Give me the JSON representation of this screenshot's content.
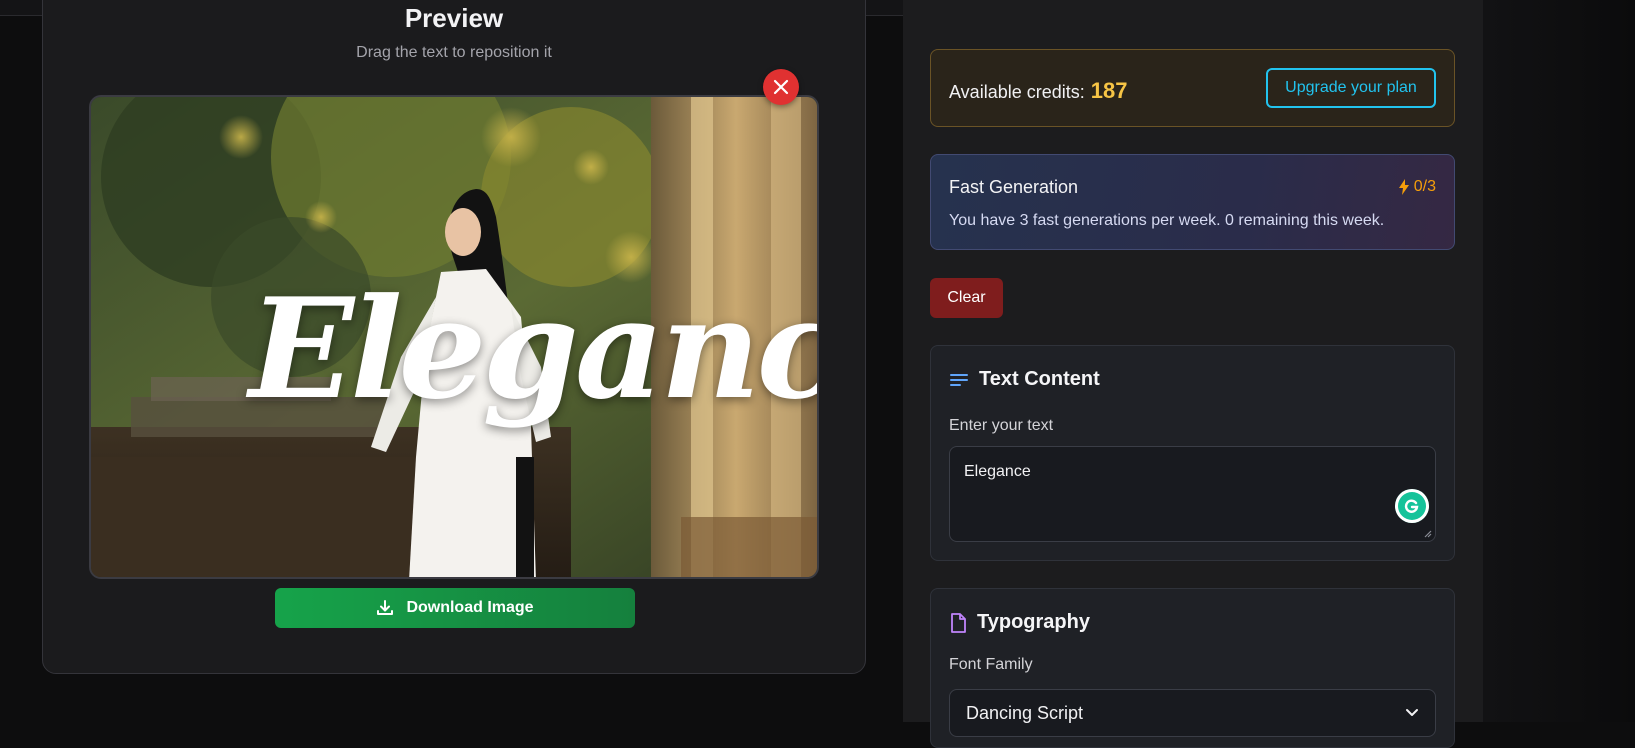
{
  "preview": {
    "title": "Preview",
    "subtitle": "Drag the text to reposition it",
    "overlay_text": "Elegance",
    "download_label": "Download Image"
  },
  "credits": {
    "label": "Available credits:",
    "value": "187",
    "upgrade_label": "Upgrade your plan"
  },
  "fast_generation": {
    "title": "Fast Generation",
    "count": "0/3",
    "description": "You have 3 fast generations per week. 0 remaining this week."
  },
  "clear_label": "Clear",
  "text_content": {
    "heading": "Text Content",
    "field_label": "Enter your text",
    "value": "Elegance"
  },
  "typography": {
    "heading": "Typography",
    "font_family_label": "Font Family",
    "font_family_value": "Dancing Script"
  },
  "colors": {
    "accent_cyan": "#22c3ee",
    "credits_gold": "#f6c445",
    "download_green": "#16a34a",
    "clear_red": "#7f1d1d",
    "close_red": "#e03131",
    "fast_amber": "#f59e0b"
  },
  "icons": {
    "close": "close-icon",
    "download": "download-icon",
    "lightning": "lightning-icon",
    "text_lines": "text-lines-icon",
    "document": "document-icon",
    "grammarly": "grammarly-icon",
    "chevron": "chevron-down-icon"
  }
}
